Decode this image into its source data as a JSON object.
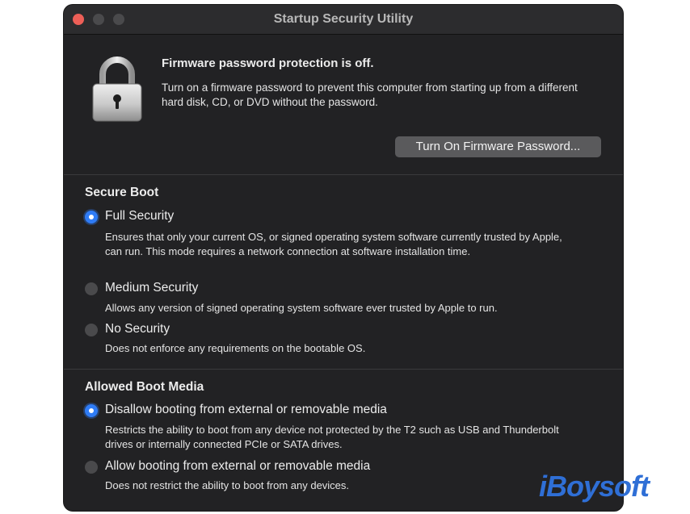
{
  "window": {
    "title": "Startup Security Utility"
  },
  "firmware": {
    "heading": "Firmware password protection is off.",
    "description": "Turn on a firmware password to prevent this computer from starting up from a different hard disk, CD, or DVD without the password.",
    "button_label": "Turn On Firmware Password..."
  },
  "secure_boot": {
    "title": "Secure Boot",
    "selected": "Full Security",
    "options": [
      {
        "label": "Full Security",
        "description": "Ensures that only your current OS, or signed operating system software currently trusted by Apple, can run. This mode requires a network connection at software installation time.",
        "selected": true
      },
      {
        "label": "Medium Security",
        "description": "Allows any version of signed operating system software ever trusted by Apple to run.",
        "selected": false
      },
      {
        "label": "No Security",
        "description": "Does not enforce any requirements on the bootable OS.",
        "selected": false
      }
    ]
  },
  "boot_media": {
    "title": "Allowed Boot Media",
    "selected": "Disallow booting from external or removable media",
    "options": [
      {
        "label": "Disallow booting from external or removable media",
        "description": "Restricts the ability to boot from any device not protected by the T2 such as USB and Thunderbolt drives or internally connected PCIe or SATA drives.",
        "selected": true
      },
      {
        "label": "Allow booting from external or removable media",
        "description": "Does not restrict the ability to boot from any devices.",
        "selected": false
      }
    ]
  },
  "watermark": "iBoysoft",
  "colors": {
    "accent": "#2f7cf6",
    "window_bg": "#222224",
    "close": "#ed5f57",
    "watermark": "#2f6fd6"
  },
  "icons": {
    "lock": "padlock-icon"
  }
}
